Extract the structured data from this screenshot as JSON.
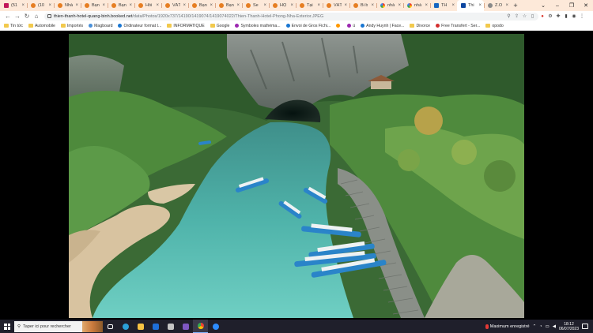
{
  "browser": {
    "tabs": [
      {
        "title": "(51",
        "icon": "mail-icon",
        "kind": "mail"
      },
      {
        "title": "(10",
        "icon": "site-icon",
        "kind": "orange"
      },
      {
        "title": "Nhà",
        "icon": "site-icon",
        "kind": "orange"
      },
      {
        "title": "Bạn",
        "icon": "site-icon",
        "kind": "orange"
      },
      {
        "title": "Bạn",
        "icon": "site-icon",
        "kind": "orange"
      },
      {
        "title": "Hồi",
        "icon": "site-icon",
        "kind": "orange"
      },
      {
        "title": "VĂT",
        "icon": "site-icon",
        "kind": "orange"
      },
      {
        "title": "Bạn",
        "icon": "site-icon",
        "kind": "orange"
      },
      {
        "title": "Bạn",
        "icon": "site-icon",
        "kind": "orange"
      },
      {
        "title": "Se",
        "icon": "site-icon",
        "kind": "orange"
      },
      {
        "title": "HỌ",
        "icon": "site-icon",
        "kind": "orange"
      },
      {
        "title": "Tại",
        "icon": "site-icon",
        "kind": "orange"
      },
      {
        "title": "VĂT",
        "icon": "site-icon",
        "kind": "orange"
      },
      {
        "title": "Bi b",
        "icon": "site-icon",
        "kind": "orange"
      },
      {
        "title": "nhà",
        "icon": "google-icon",
        "kind": "google"
      },
      {
        "title": "nhà",
        "icon": "google-icon",
        "kind": "google"
      },
      {
        "title": "TH",
        "icon": "site-icon",
        "kind": "blue"
      },
      {
        "title": "Thi",
        "icon": "booking-icon",
        "kind": "dark",
        "active": true
      },
      {
        "title": "Z.O",
        "icon": "site-icon",
        "kind": "grey"
      }
    ],
    "new_tab_label": "+",
    "url_host": "thien-thanh-hotel-quang-binh.booked.net",
    "url_path": "/data/Photos/1920x737/14190/1419074/1419074022/Thien-Thanh-Hotel-Phong-Nha-Exterior.JPEG",
    "bookmarks": [
      {
        "label": "Tin tức",
        "icon": "folder-icon",
        "kind": "folder"
      },
      {
        "label": "Automobile",
        "icon": "folder-icon",
        "kind": "folder"
      },
      {
        "label": "Importés",
        "icon": "folder-icon",
        "kind": "folder"
      },
      {
        "label": "Magboard",
        "icon": "magboard-icon",
        "kind": "dot"
      },
      {
        "label": "Ordinateur format t...",
        "icon": "globe-icon",
        "kind": "blue"
      },
      {
        "label": "INFORMATIQUE",
        "icon": "folder-icon",
        "kind": "folder"
      },
      {
        "label": "Google",
        "icon": "folder-icon",
        "kind": "folder"
      },
      {
        "label": "Symboles mathéma...",
        "icon": "site-icon",
        "kind": "purple"
      },
      {
        "label": "Envoi de Gros Fichi...",
        "icon": "site-icon",
        "kind": "blue"
      },
      {
        "label": "",
        "icon": "site-icon",
        "kind": "orange"
      },
      {
        "label": "ü",
        "icon": "site-icon",
        "kind": "purple"
      },
      {
        "label": "Andy Huynh | Face...",
        "icon": "facebook-icon",
        "kind": "blue"
      },
      {
        "label": "Divorce",
        "icon": "folder-icon",
        "kind": "folder"
      },
      {
        "label": "Free Transfert - Ser...",
        "icon": "site-icon",
        "kind": "red"
      },
      {
        "label": "opodo",
        "icon": "folder-icon",
        "kind": "folder"
      }
    ]
  },
  "taskbar": {
    "search_placeholder": "Taper ici pour rechercher",
    "recording_label": "Maximum enregistré",
    "time": "18:12",
    "date": "06/07/2023"
  }
}
